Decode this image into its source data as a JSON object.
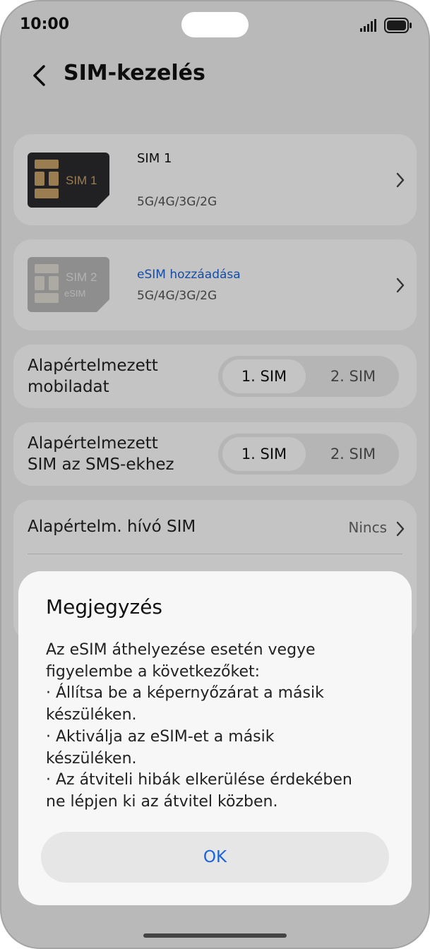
{
  "status_bar": {
    "time": "10:00"
  },
  "header": {
    "title": "SIM-kezelés"
  },
  "sim1": {
    "card_label": "SIM 1",
    "name": "SIM 1",
    "network": "5G/4G/3G/2G"
  },
  "sim2": {
    "card_label": "SIM 2",
    "card_sublabel": "eSIM",
    "link": "eSIM hozzáadása",
    "network": "5G/4G/3G/2G"
  },
  "mobile_data": {
    "label_line1": "Alapértelmezett",
    "label_line2": "mobiladat",
    "option_selected": "1. SIM",
    "option_other": "2. SIM"
  },
  "sms": {
    "label_line1": "Alapértelmezett",
    "label_line2": "SIM az SMS-ekhez",
    "option_selected": "1. SIM",
    "option_other": "2. SIM"
  },
  "call": {
    "label": "Alapértelm. hívó SIM",
    "value": "Nincs"
  },
  "dialog": {
    "title": "Megjegyzés",
    "lines": [
      "Az eSIM áthelyezése esetén vegye",
      "figyelembe a következőket:",
      "· Állítsa be a képernyőzárat a másik",
      "készüléken.",
      "· Aktiválja az eSIM-et a másik",
      "készüléken.",
      "· Az átviteli hibák elkerülése érdekében",
      "ne lépjen ki az átvitel közben."
    ],
    "ok_label": "OK"
  },
  "colors": {
    "accent": "#1a63d8",
    "background": "#f1f1f1",
    "card": "#ffffff"
  }
}
